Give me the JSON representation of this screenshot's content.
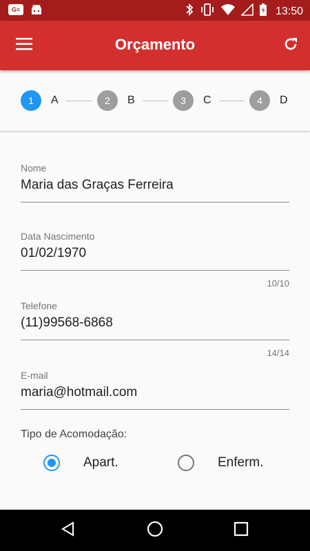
{
  "status_bar": {
    "time": "13:50",
    "notification_badge": "G≡"
  },
  "app_bar": {
    "title": "Orçamento",
    "menu_icon": "menu-icon",
    "refresh_icon": "refresh-icon",
    "color": "#d32f2f"
  },
  "stepper": {
    "steps": [
      {
        "number": "1",
        "label": "A",
        "active": true
      },
      {
        "number": "2",
        "label": "B",
        "active": false
      },
      {
        "number": "3",
        "label": "C",
        "active": false
      },
      {
        "number": "4",
        "label": "D",
        "active": false
      }
    ],
    "active_color": "#2196f3",
    "inactive_color": "#9e9e9e"
  },
  "form": {
    "nome": {
      "label": "Nome",
      "value": "Maria das Graças Ferreira"
    },
    "data_nascimento": {
      "label": "Data Nascimento",
      "value": "01/02/1970",
      "counter": "10/10"
    },
    "telefone": {
      "label": "Telefone",
      "value": "(11)99568-6868",
      "counter": "14/14"
    },
    "email": {
      "label": "E-mail",
      "value": "maria@hotmail.com"
    },
    "acomodacao": {
      "label": "Tipo de Acomodação:",
      "options": [
        {
          "label": "Apart.",
          "selected": true
        },
        {
          "label": "Enferm.",
          "selected": false
        }
      ]
    }
  },
  "nav_bar": {
    "back_icon": "back-icon",
    "home_icon": "home-icon",
    "recents_icon": "recents-icon"
  }
}
